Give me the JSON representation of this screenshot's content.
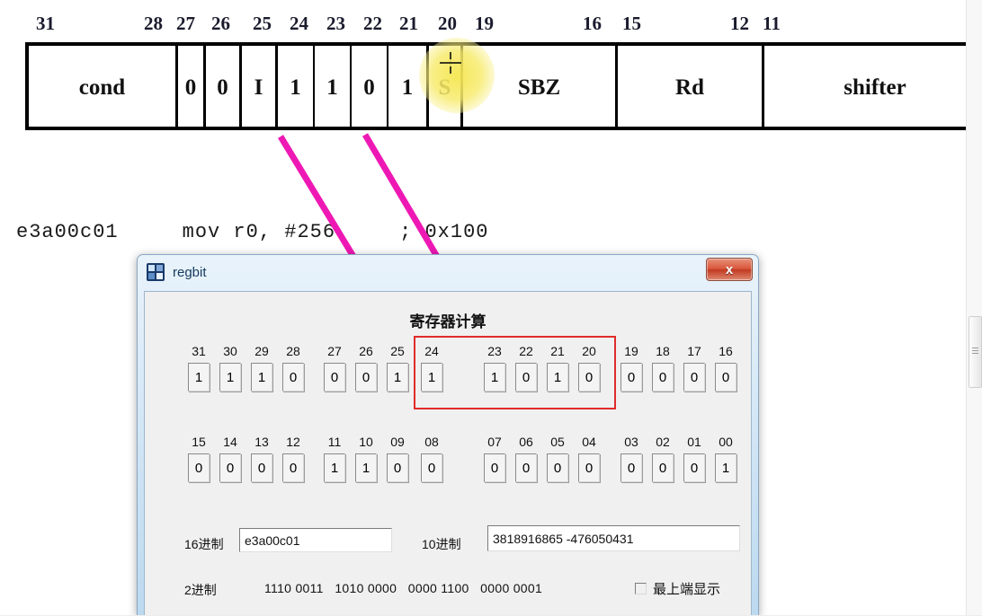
{
  "encoding_diagram": {
    "bit_labels": [
      "31",
      "28",
      "27",
      "26",
      "25",
      "24",
      "23",
      "22",
      "21",
      "20",
      "19",
      "16",
      "15",
      "12",
      "11"
    ],
    "fields": [
      {
        "label": "cond"
      },
      {
        "label": "0"
      },
      {
        "label": "0"
      },
      {
        "label": "I"
      },
      {
        "label": "1"
      },
      {
        "label": "1"
      },
      {
        "label": "0"
      },
      {
        "label": "1"
      },
      {
        "label": "S"
      },
      {
        "label": "SBZ"
      },
      {
        "label": "Rd"
      },
      {
        "label": "shifter"
      }
    ],
    "highlighted_field": "S"
  },
  "assembly": {
    "line": "e3a00c01     mov r0, #256     ; 0x100",
    "machine_code": "e3a00c01",
    "mnemonic": "mov r0, #256",
    "comment": "; 0x100"
  },
  "dialog": {
    "title": "regbit",
    "icon": "app-icon",
    "close_label": "x",
    "heading": "寄存器计算",
    "bit_rows": [
      {
        "groups": [
          {
            "bits": [
              {
                "num": "31",
                "value": "1"
              },
              {
                "num": "30",
                "value": "1"
              },
              {
                "num": "29",
                "value": "1"
              },
              {
                "num": "28",
                "value": "0"
              }
            ]
          },
          {
            "bits": [
              {
                "num": "27",
                "value": "0"
              },
              {
                "num": "26",
                "value": "0"
              },
              {
                "num": "25",
                "value": "1"
              },
              {
                "num": "24",
                "value": "1"
              }
            ]
          },
          {
            "bits": [
              {
                "num": "23",
                "value": "1"
              },
              {
                "num": "22",
                "value": "0"
              },
              {
                "num": "21",
                "value": "1"
              },
              {
                "num": "20",
                "value": "0"
              }
            ]
          },
          {
            "bits": [
              {
                "num": "19",
                "value": "0"
              },
              {
                "num": "18",
                "value": "0"
              },
              {
                "num": "17",
                "value": "0"
              },
              {
                "num": "16",
                "value": "0"
              }
            ]
          }
        ]
      },
      {
        "groups": [
          {
            "bits": [
              {
                "num": "15",
                "value": "0"
              },
              {
                "num": "14",
                "value": "0"
              },
              {
                "num": "13",
                "value": "0"
              },
              {
                "num": "12",
                "value": "0"
              }
            ]
          },
          {
            "bits": [
              {
                "num": "11",
                "value": "1"
              },
              {
                "num": "10",
                "value": "1"
              },
              {
                "num": "09",
                "value": "0"
              },
              {
                "num": "08",
                "value": "0"
              }
            ]
          },
          {
            "bits": [
              {
                "num": "07",
                "value": "0"
              },
              {
                "num": "06",
                "value": "0"
              },
              {
                "num": "05",
                "value": "0"
              },
              {
                "num": "04",
                "value": "0"
              }
            ]
          },
          {
            "bits": [
              {
                "num": "03",
                "value": "0"
              },
              {
                "num": "02",
                "value": "0"
              },
              {
                "num": "01",
                "value": "0"
              },
              {
                "num": "00",
                "value": "1"
              }
            ]
          }
        ]
      }
    ],
    "hex": {
      "label": "16进制",
      "value": "e3a00c01"
    },
    "dec": {
      "label": "10进制",
      "value": "3818916865   -476050431"
    },
    "bin": {
      "label": "2进制",
      "value": "1110 0011   1010 0000   0000 1100   0000 0001"
    },
    "topmost_checkbox": {
      "label": "最上端显示",
      "checked": false
    }
  },
  "colors": {
    "highlight": "#f2e24a",
    "arrow": "#ee19b4",
    "red_box": "#e02b2b",
    "title_bar": "#cfe4f5"
  }
}
